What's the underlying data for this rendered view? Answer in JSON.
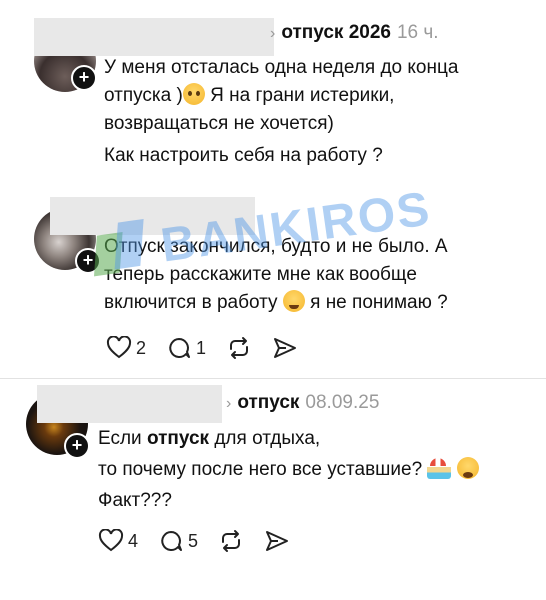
{
  "posts": [
    {
      "topic": "отпуск 2026",
      "time": "16 ч.",
      "text_lines": [
        "У меня отсталась одна неделя до конца",
        "отпуска )",
        "Я на грани истерики,",
        "возвращаться  не хочется)",
        "Как настроить себя на работу ?"
      ],
      "emoji": "pleading-face-emoji"
    },
    {
      "text_part1": "Отпуск",
      "text_part2": " закончился, будто и не было. А",
      "text_lines": [
        "теперь расскажите мне как вообще",
        "включится в работу",
        " я не понимаю ?"
      ],
      "emoji": "laughing-face-emoji",
      "likes": "2",
      "replies": "1"
    },
    {
      "topic": "отпуск",
      "time": "08.09.25",
      "line1_pre": "Если ",
      "line1_bold": "отпуск",
      "line1_post": " для отдыха,",
      "line2": "то почему после него все уставшие?",
      "line3": "Факт???",
      "emojis": [
        "beach-umbrella-emoji",
        "yawning-face-emoji"
      ],
      "likes": "4",
      "replies": "5"
    }
  ],
  "watermark": "BANKIROS",
  "icons": [
    "heart-icon",
    "comment-icon",
    "repost-icon",
    "share-icon",
    "plus-icon",
    "chevron-right-icon"
  ]
}
